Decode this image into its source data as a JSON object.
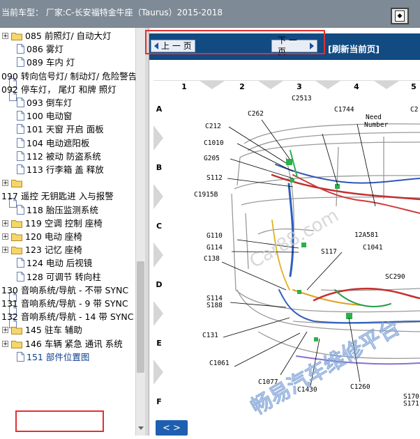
{
  "window": {
    "title": "当前车型：  厂家:C-长安福特金牛座（Taurus）2015-2018"
  },
  "tree": [
    {
      "label": "085 前照灯/ 自动大灯",
      "kind": "folder",
      "indent": 1,
      "expander": "+"
    },
    {
      "label": "086 雾灯",
      "kind": "doc",
      "indent": 2
    },
    {
      "label": "089 车内 灯",
      "kind": "doc",
      "indent": 2
    },
    {
      "label": "090 转向信号灯/ 制动灯/ 危险警告",
      "kind": "doc",
      "indent": 0
    },
    {
      "label": "092 停车灯， 尾灯 和牌 照灯",
      "kind": "doc",
      "indent": 0
    },
    {
      "label": "093 倒车灯",
      "kind": "doc",
      "indent": 2
    },
    {
      "label": "100 电动窗",
      "kind": "doc",
      "indent": 2
    },
    {
      "label": "101 天窗 开启 面板",
      "kind": "doc",
      "indent": 2
    },
    {
      "label": "104 电动遮阳板",
      "kind": "doc",
      "indent": 2
    },
    {
      "label": "112 被动 防盗系统",
      "kind": "doc",
      "indent": 2
    },
    {
      "label": "113 行李箱 盖 释放",
      "kind": "doc",
      "indent": 2
    },
    {
      "label": "",
      "kind": "folder",
      "indent": 1,
      "expander": "+"
    },
    {
      "label": "117 遥控 无钥匙进 入与报警",
      "kind": "doc",
      "indent": 0
    },
    {
      "label": "118 胎压监测系统",
      "kind": "doc",
      "indent": 2
    },
    {
      "label": "119 空调 控制 座椅",
      "kind": "folder",
      "indent": 1,
      "expander": "+"
    },
    {
      "label": "120 电动 座椅",
      "kind": "folder",
      "indent": 1,
      "expander": "+"
    },
    {
      "label": "123 记忆 座椅",
      "kind": "folder",
      "indent": 1,
      "expander": "+"
    },
    {
      "label": "124 电动 后视镜",
      "kind": "doc",
      "indent": 2
    },
    {
      "label": "128 可调节 转向柱",
      "kind": "doc",
      "indent": 2
    },
    {
      "label": "130 音响系统/导航 - 不带 SYNC",
      "kind": "doc",
      "indent": 0
    },
    {
      "label": "131 音响系统/导航 - 9 带 SYNC",
      "kind": "doc",
      "indent": 0
    },
    {
      "label": "132 音响系统/导航 - 14 带 SYNC",
      "kind": "doc",
      "indent": 0
    },
    {
      "label": "145 驻车 辅助",
      "kind": "folder",
      "indent": 1,
      "expander": "+"
    },
    {
      "label": "146 车辆 紧急 通讯 系统",
      "kind": "folder",
      "indent": 1,
      "expander": "+"
    },
    {
      "label": "151 部件位置图",
      "kind": "doc",
      "indent": 2,
      "selected": true
    }
  ],
  "nav": {
    "prev_label": "上 一 页",
    "next_label": "下 一 页",
    "refresh_label": "[刷新当前页]",
    "toggle_label": "< >"
  },
  "diagram": {
    "col_labels": [
      "1",
      "2",
      "3",
      "4",
      "5"
    ],
    "row_labels": [
      "A",
      "B",
      "C",
      "D",
      "E",
      "F"
    ],
    "callouts": [
      "C2513",
      "C262",
      "C1744",
      "Need Number",
      "C2",
      "C212",
      "C1010",
      "G205",
      "S112",
      "C1915B",
      "12A581",
      "G110",
      "G114",
      "S117",
      "C1041",
      "C138",
      "SC290",
      "S114",
      "S188",
      "C131",
      "C1061",
      "C1077",
      "C1430",
      "C1260",
      "S170",
      "S171"
    ],
    "watermark": "畅易汽车维修平台",
    "watermark_sub": "Car88.com"
  },
  "colors": {
    "titlebar": "#7e8a96",
    "navbar": "#124a82",
    "highlight_box": "#e03030",
    "selected_item": "#0a3d8f"
  }
}
